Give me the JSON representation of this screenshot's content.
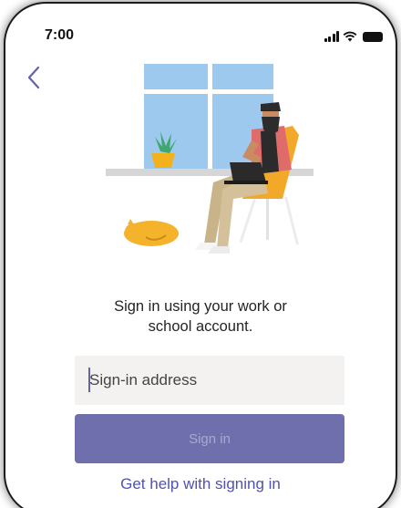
{
  "status_bar": {
    "time": "7:00",
    "icons": [
      "signal-icon",
      "wifi-icon",
      "battery-icon"
    ]
  },
  "navigation": {
    "back_icon": "chevron-left-icon"
  },
  "illustration": {
    "description_icon": "person-with-laptop-illustration"
  },
  "prompt": {
    "line1": "Sign in using your work or",
    "line2": "school account."
  },
  "signin_input": {
    "value": "",
    "placeholder": "Sign-in address"
  },
  "signin_button": {
    "label": "Sign in"
  },
  "help_link": {
    "label": "Get help with signing in"
  },
  "colors": {
    "accent": "#6264a7",
    "button_bg": "#6f6fae",
    "link": "#4f52b2",
    "input_bg": "#f3f2f1"
  }
}
